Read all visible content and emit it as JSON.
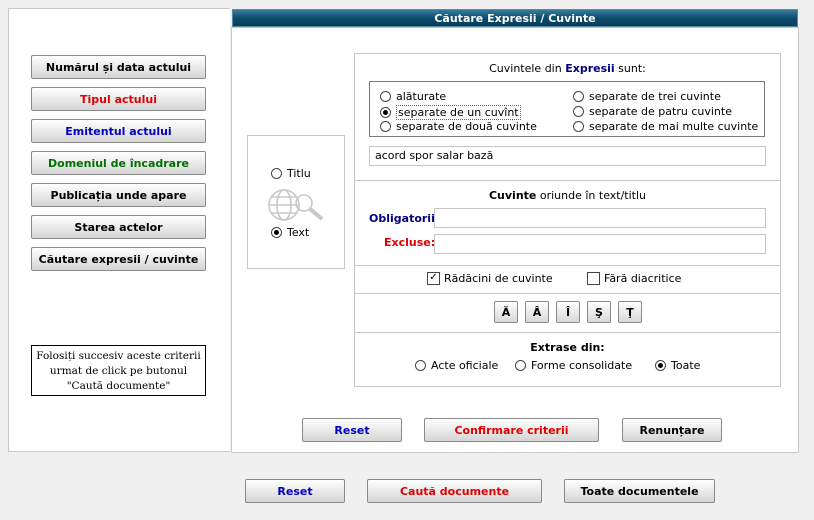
{
  "header": {
    "title": "Căutare Expresii / Cuvinte"
  },
  "criteria_buttons": [
    {
      "label": "Numărul și data actului",
      "color": "#000000"
    },
    {
      "label": "Tipul actului",
      "color": "#e00000"
    },
    {
      "label": "Emitentul actului",
      "color": "#0000c0"
    },
    {
      "label": "Domeniul de încadrare",
      "color": "#007000"
    },
    {
      "label": "Publicația unde apare",
      "color": "#000000"
    },
    {
      "label": "Starea actelor",
      "color": "#000000"
    },
    {
      "label": "Căutare expresii / cuvinte",
      "color": "#000000"
    }
  ],
  "hint": "Folosiți succesiv aceste criterii urmat de click pe butonul \"Caută documente\"",
  "scope": {
    "title_label": "Titlu",
    "text_label": "Text",
    "selected": "text"
  },
  "expressions": {
    "heading_pre": "Cuvintele din ",
    "heading_key": "Expresii",
    "heading_post": " sunt:",
    "options": [
      {
        "label": "alăturate",
        "selected": false
      },
      {
        "label": "separate de un cuvînt",
        "selected": true
      },
      {
        "label": "separate de două cuvinte",
        "selected": false
      },
      {
        "label": "separate de trei cuvinte",
        "selected": false
      },
      {
        "label": "separate de patru cuvinte",
        "selected": false
      },
      {
        "label": "separate de mai multe cuvinte",
        "selected": false
      }
    ],
    "value": "acord spor salar bază"
  },
  "words": {
    "heading_key": "Cuvinte",
    "heading_post": " oriunde în text/titlu",
    "required_label": "Obligatorii:",
    "required_value": "",
    "excluded_label": "Excluse:",
    "excluded_value": ""
  },
  "options": {
    "roots_label": "Rădăcini de cuvinte",
    "roots_checked": true,
    "no_diacritics_label": "Fără diacritice",
    "no_diacritics_checked": false
  },
  "diacritics": [
    "Ă",
    "Â",
    "Î",
    "Ş",
    "Ţ"
  ],
  "extract": {
    "heading": "Extrase din:",
    "options": [
      {
        "label": "Acte oficiale",
        "selected": false
      },
      {
        "label": "Forme consolidate",
        "selected": false
      },
      {
        "label": "Toate",
        "selected": true
      }
    ]
  },
  "panel_buttons": {
    "reset": "Reset",
    "confirm": "Confirmare criterii",
    "cancel": "Renunțare"
  },
  "footer_buttons": {
    "reset": "Reset",
    "search": "Caută documente",
    "all": "Toate documentele"
  }
}
